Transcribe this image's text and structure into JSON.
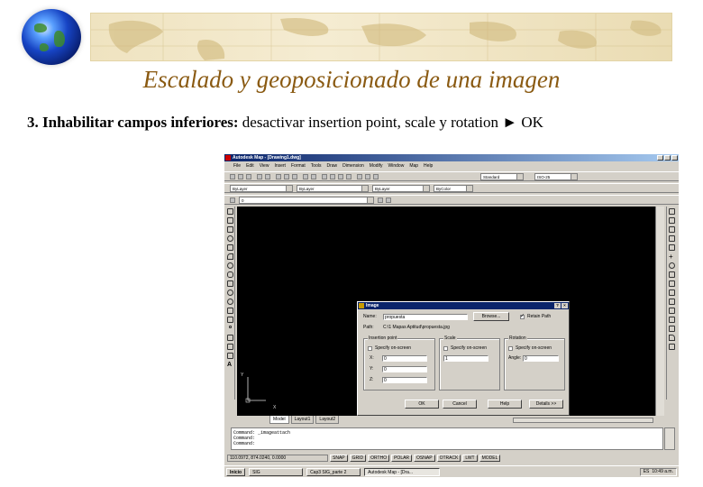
{
  "slide": {
    "title": "Escalado y  geoposicionado de una imagen",
    "step_bold": "3. Inhabilitar campos inferiores:",
    "step_text": " desactivar insertion point, scale y  rotation",
    "step_arrow": "►",
    "step_ok": "OK"
  },
  "app": {
    "title": "Autodesk Map - [Drawing1.dwg]",
    "menu": [
      "File",
      "Edit",
      "View",
      "Insert",
      "Format",
      "Tools",
      "Draw",
      "Dimension",
      "Modify",
      "Window",
      "Map",
      "Help"
    ],
    "style_combo": "Standard",
    "dim_combo": "ISO-25",
    "layer_combo": "ByLayer",
    "linetype_combo": "ByLayer",
    "lineweight_combo": "ByLayer",
    "color_combo": "ByColor",
    "layer_state": "0",
    "ucs_x": "X",
    "ucs_y": "Y",
    "tabs": [
      "Model",
      "Layout1",
      "Layout2"
    ],
    "command_lines": [
      "Command: _imageattach",
      "Command:",
      "Command:"
    ],
    "coords": "110.0972, 874.0240, 0.0000",
    "status_buttons": [
      "SNAP",
      "GRID",
      "ORTHO",
      "POLAR",
      "OSNAP",
      "OTRACK",
      "LWT",
      "MODEL"
    ]
  },
  "dialog": {
    "title": "Image",
    "help_glyph": "?",
    "close_glyph": "×",
    "name_label": "Name:",
    "name_value": "propuesta",
    "browse_label": "Browse...",
    "retain_path_label": "Retain Path",
    "retain_path_checked": true,
    "path_label": "Path:",
    "path_value": "C:\\1 Mapas Aptitud\\propuesta.jpg",
    "insertion": {
      "title": "Insertion point",
      "specify_label": "Specify on-screen",
      "x_label": "X:",
      "x_value": "0",
      "y_label": "Y:",
      "y_value": "0",
      "z_label": "Z:",
      "z_value": "0"
    },
    "scale": {
      "title": "Scale",
      "specify_label": "Specify on-screen",
      "value": "1"
    },
    "rotation": {
      "title": "Rotation",
      "specify_label": "Specify on-screen",
      "angle_label": "Angle:",
      "angle_value": "0"
    },
    "buttons": {
      "ok": "OK",
      "cancel": "Cancel",
      "help": "Help",
      "details": "Details >>"
    }
  },
  "taskbar": {
    "start": "Inicio",
    "tasks": [
      "SIG",
      "Cap3 SIG_parte 2",
      "Autodesk Map - [Dra..."
    ],
    "lang": "ES",
    "clock": "10:49 a.m."
  }
}
